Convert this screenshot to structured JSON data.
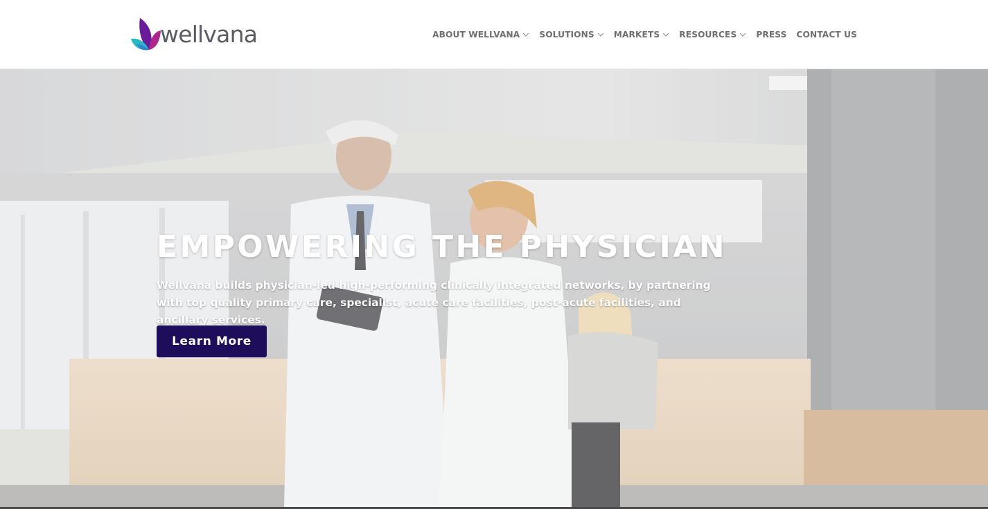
{
  "brand": {
    "name": "wellvana",
    "logo_icon": "lotus-petal-logo-icon",
    "colors": {
      "petal_purple": "#6a1b9a",
      "petal_magenta": "#b0258d",
      "petal_teal": "#27b9c6",
      "text_gray": "#5b5b66"
    }
  },
  "nav": {
    "items": [
      {
        "label": "ABOUT WELLVANA",
        "has_dropdown": true
      },
      {
        "label": "SOLUTIONS",
        "has_dropdown": true
      },
      {
        "label": "MARKETS",
        "has_dropdown": true
      },
      {
        "label": "RESOURCES",
        "has_dropdown": true
      },
      {
        "label": "PRESS",
        "has_dropdown": false
      },
      {
        "label": "CONTACT US",
        "has_dropdown": false
      }
    ],
    "dropdown_icon": "chevron-down-icon",
    "text_color": "#6f6f6f"
  },
  "hero": {
    "title": "EMPOWERING THE PHYSICIAN",
    "subtitle": "Wellvana builds physician-led high-performing clinically integrated networks, by partnering with top quality primary care, specialist, acute care facilities, post-acute facilities, and ancillary services.",
    "cta_label": "Learn More",
    "cta_color": "#1d0d5a"
  }
}
